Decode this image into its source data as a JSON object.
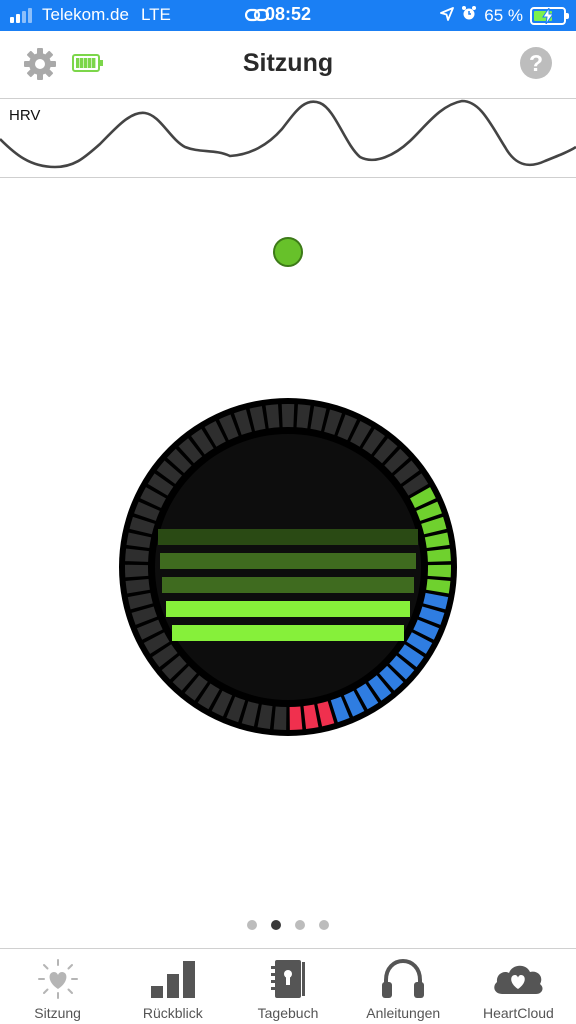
{
  "status_bar": {
    "carrier": "Telekom.de",
    "network": "LTE",
    "time": "08:52",
    "battery_percent": "65 %",
    "battery_level": 0.65,
    "icons": [
      "signal-icon",
      "link-icon",
      "location-arrow-icon",
      "alarm-icon",
      "battery-charging-icon"
    ]
  },
  "nav": {
    "title": "Sitzung",
    "left_icons": [
      "gear-icon",
      "device-battery-icon"
    ],
    "help_label": "?"
  },
  "hrv": {
    "label": "HRV"
  },
  "indicator": {
    "color": "#67c12a"
  },
  "gauge": {
    "ring_segments": [
      "gray",
      "gray",
      "gray",
      "gray",
      "gray",
      "gray",
      "gray",
      "gray",
      "gray",
      "gray",
      "gray",
      "gray",
      "gray",
      "gray",
      "gray",
      "gray",
      "gray",
      "gray",
      "gray",
      "gray",
      "gray",
      "gray",
      "gray",
      "gray",
      "gray",
      "gray",
      "gray",
      "gray",
      "gray",
      "gray",
      "gray",
      "gray",
      "gray",
      "gray",
      "gray",
      "gray",
      "gray",
      "gray",
      "gray",
      "gray",
      "gray",
      "gray",
      "green",
      "green",
      "green",
      "green",
      "green",
      "green",
      "green",
      "blue",
      "blue",
      "blue",
      "blue",
      "blue",
      "blue",
      "blue",
      "blue",
      "blue",
      "blue",
      "blue",
      "red",
      "red",
      "red"
    ],
    "bar_levels": [
      1,
      2,
      3,
      4,
      5
    ],
    "colors": {
      "gray": "#2e2e2e",
      "green": "#6fd12e",
      "blue": "#2f7de1",
      "red": "#f0304e",
      "bar_dim": "#2a4a14",
      "bar_mid": "#3f6b1f",
      "bar_bright": "#86f03a"
    }
  },
  "pager": {
    "count": 4,
    "active": 1
  },
  "tabs": [
    {
      "label": "Sitzung",
      "icon": "heart-sun-icon",
      "active": true
    },
    {
      "label": "Rückblick",
      "icon": "bar-chart-icon",
      "active": false
    },
    {
      "label": "Tagebuch",
      "icon": "journal-icon",
      "active": false
    },
    {
      "label": "Anleitungen",
      "icon": "headphones-icon",
      "active": false
    },
    {
      "label": "HeartCloud",
      "icon": "heart-cloud-icon",
      "active": false
    }
  ]
}
